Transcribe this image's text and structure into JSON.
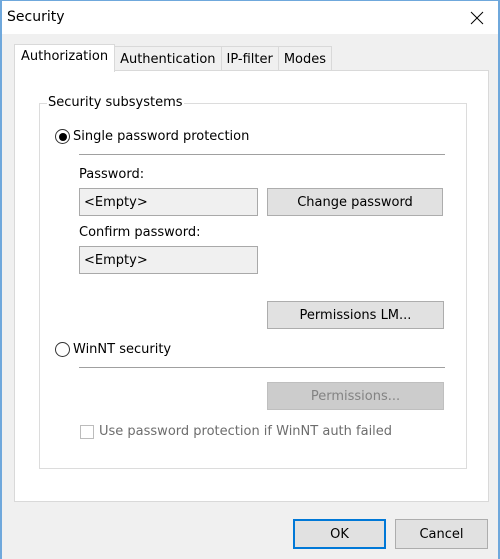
{
  "window": {
    "title": "Security",
    "close_icon": "close-icon"
  },
  "tabs": [
    {
      "label": "Authorization",
      "active": true
    },
    {
      "label": "Authentication",
      "active": false
    },
    {
      "label": "IP-filter",
      "active": false
    },
    {
      "label": "Modes",
      "active": false
    }
  ],
  "group": {
    "legend": "Security subsystems",
    "single_password": {
      "label": "Single password protection",
      "selected": true,
      "password_label": "Password:",
      "password_value": "<Empty>",
      "confirm_label": "Confirm password:",
      "confirm_value": "<Empty>",
      "change_password_button": "Change password",
      "permissions_lm_button": "Permissions LM..."
    },
    "winnt": {
      "label": "WinNT security",
      "selected": false,
      "permissions_button": "Permissions...",
      "permissions_enabled": false,
      "fallback_checkbox_label": "Use password protection if WinNT auth failed",
      "fallback_checked": false,
      "fallback_enabled": false
    }
  },
  "footer": {
    "ok_label": "OK",
    "cancel_label": "Cancel"
  }
}
